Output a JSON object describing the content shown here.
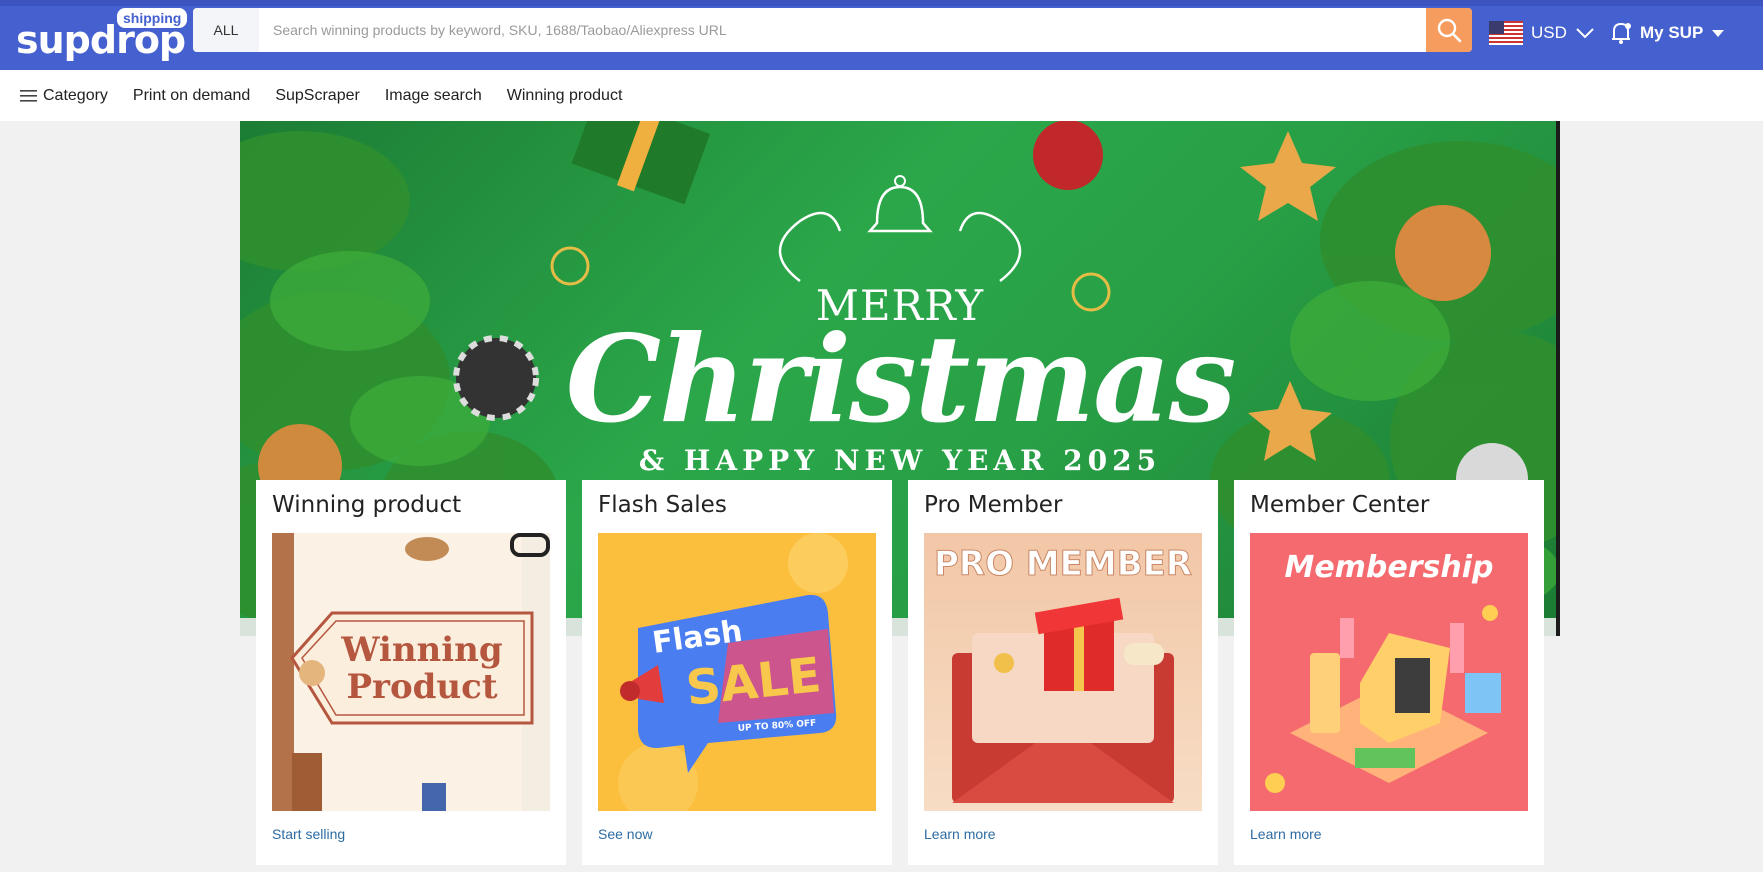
{
  "header": {
    "logo_text": "supdrop",
    "logo_tag": "shipping",
    "search_scope": "ALL",
    "search_placeholder": "Search winning products by keyword, SKU, 1688/Taobao/Aliexpress URL",
    "currency": "USD",
    "account_label": "My SUP"
  },
  "nav": {
    "category": "Category",
    "items": [
      "Print on demand",
      "SupScraper",
      "Image search",
      "Winning product"
    ]
  },
  "banner": {
    "line1": "MERRY",
    "line2": "Christmas",
    "line3": "& HAPPY NEW YEAR 2025"
  },
  "cards": [
    {
      "title": "Winning product",
      "image_text_1": "Winning",
      "image_text_2": "Product",
      "link": "Start selling"
    },
    {
      "title": "Flash Sales",
      "image_text_1": "Flash",
      "image_text_2": "SALE",
      "image_text_3": "UP TO 80% OFF",
      "link": "See now"
    },
    {
      "title": "Pro Member",
      "image_text_1": "PRO MEMBER",
      "link": "Learn more"
    },
    {
      "title": "Member Center",
      "image_text_1": "Membership",
      "link": "Learn more"
    }
  ],
  "colors": {
    "brand": "#4560cf",
    "search_button": "#f59c5e",
    "link": "#2d6ca3"
  }
}
